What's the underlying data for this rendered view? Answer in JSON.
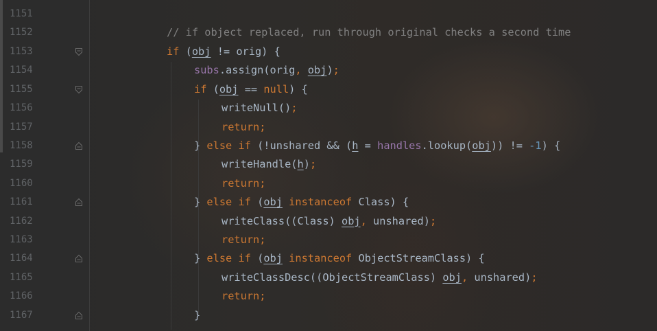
{
  "line_numbers": [
    "1151",
    "1152",
    "1153",
    "1154",
    "1155",
    "1156",
    "1157",
    "1158",
    "1159",
    "1160",
    "1161",
    "1162",
    "1163",
    "1164",
    "1165",
    "1166",
    "1167"
  ],
  "code": {
    "l1152_comment": "// if object replaced, run through original checks a second time",
    "l1153_if": "if",
    "l1153_a": " (",
    "l1153_obj": "obj",
    "l1153_b": " != orig) {",
    "l1154_subs": "subs",
    "l1154_a": ".assign(orig",
    "l1154_comma": ",",
    "l1154_sp": " ",
    "l1154_obj": "obj",
    "l1154_b": ")",
    "l1154_semi": ";",
    "l1155_if": "if",
    "l1155_a": " (",
    "l1155_obj": "obj",
    "l1155_b": " == ",
    "l1155_null": "null",
    "l1155_c": ") {",
    "l1156_a": "writeNull()",
    "l1156_semi": ";",
    "l1157_return": "return",
    "l1157_semi": ";",
    "l1158_a": "} ",
    "l1158_else": "else if",
    "l1158_b": " (!unshared && (",
    "l1158_h": "h",
    "l1158_c": " = ",
    "l1158_handles": "handles",
    "l1158_d": ".lookup(",
    "l1158_obj": "obj",
    "l1158_e": ")) != ",
    "l1158_num": "-1",
    "l1158_f": ") {",
    "l1159_a": "writeHandle(",
    "l1159_h": "h",
    "l1159_b": ")",
    "l1159_semi": ";",
    "l1160_return": "return",
    "l1160_semi": ";",
    "l1161_a": "} ",
    "l1161_else": "else if",
    "l1161_b": " (",
    "l1161_obj": "obj",
    "l1161_sp": " ",
    "l1161_instanceof": "instanceof",
    "l1161_c": " Class) {",
    "l1162_a": "writeClass((Class) ",
    "l1162_obj": "obj",
    "l1162_comma": ",",
    "l1162_b": " unshared)",
    "l1162_semi": ";",
    "l1163_return": "return",
    "l1163_semi": ";",
    "l1164_a": "} ",
    "l1164_else": "else if",
    "l1164_b": " (",
    "l1164_obj": "obj",
    "l1164_sp": " ",
    "l1164_instanceof": "instanceof",
    "l1164_c": " ObjectStreamClass) {",
    "l1165_a": "writeClassDesc((ObjectStreamClass) ",
    "l1165_obj": "obj",
    "l1165_comma": ",",
    "l1165_b": " unshared)",
    "l1165_semi": ";",
    "l1166_return": "return",
    "l1166_semi": ";",
    "l1167_a": "}"
  },
  "colors": {
    "background": "#2b2b2b",
    "text": "#a9b7c6",
    "keyword": "#cc7832",
    "comment": "#808080",
    "field": "#9876aa",
    "number": "#6897bb",
    "line_number": "#606366"
  },
  "icons": {
    "fold_open": "fold-open-icon",
    "fold_close": "fold-close-icon"
  }
}
